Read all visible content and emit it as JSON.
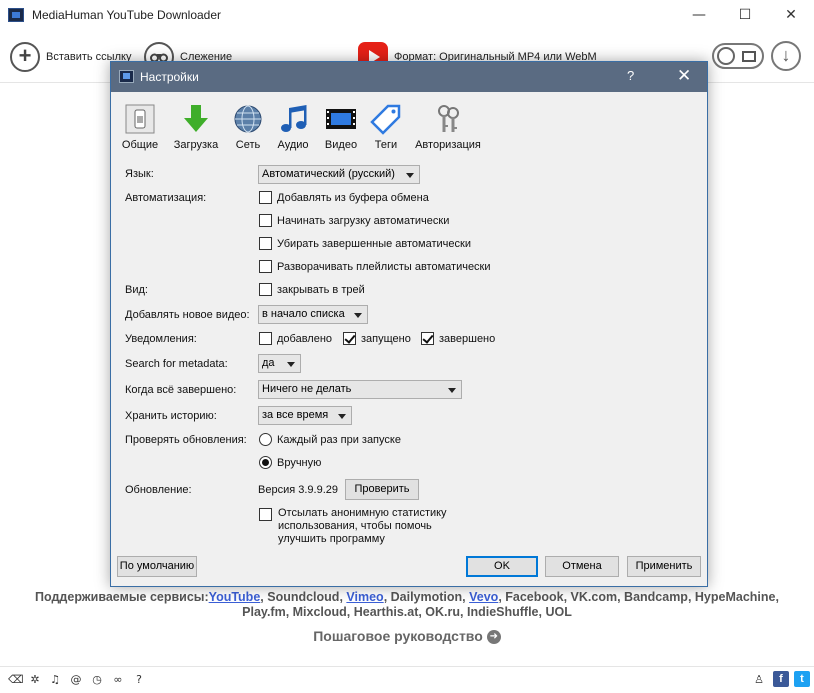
{
  "app": {
    "title": "MediaHuman YouTube Downloader",
    "window_controls": {
      "minimize": "—",
      "maximize": "☐",
      "close": "✕"
    }
  },
  "toolbar": {
    "paste_label": "Вставить ссылку",
    "tracking_label": "Слежение",
    "format_label": "Формат: Оригинальный MP4 или WebM"
  },
  "dialog": {
    "title": "Настройки",
    "help": "?",
    "close": "✕",
    "categories": [
      {
        "label": "Общие",
        "icon": "general-icon"
      },
      {
        "label": "Загрузка",
        "icon": "download-arrow-icon"
      },
      {
        "label": "Сеть",
        "icon": "globe-icon"
      },
      {
        "label": "Аудио",
        "icon": "music-note-icon"
      },
      {
        "label": "Видео",
        "icon": "film-icon"
      },
      {
        "label": "Теги",
        "icon": "tag-icon"
      },
      {
        "label": "Авторизация",
        "icon": "keys-icon"
      }
    ],
    "language": {
      "label": "Язык:",
      "value": "Автоматический (русский)"
    },
    "automation": {
      "label": "Автоматизация:",
      "options": [
        {
          "label": "Добавлять из буфера обмена",
          "checked": false
        },
        {
          "label": "Начинать загрузку автоматически",
          "checked": false
        },
        {
          "label": "Убирать завершенные автоматически",
          "checked": false
        },
        {
          "label": "Разворачивать плейлисты автоматически",
          "checked": false
        }
      ]
    },
    "view": {
      "label": "Вид:",
      "option": "закрывать в трей",
      "checked": false
    },
    "add_new": {
      "label": "Добавлять новое видео:",
      "value": "в начало списка"
    },
    "notifications": {
      "label": "Уведомления:",
      "options": [
        {
          "label": "добавлено",
          "checked": false
        },
        {
          "label": "запущено",
          "checked": true
        },
        {
          "label": "завершено",
          "checked": true
        }
      ]
    },
    "metadata": {
      "label": "Search for metadata:",
      "value": "да"
    },
    "when_done": {
      "label": "Когда всё завершено:",
      "value": "Ничего не делать"
    },
    "history": {
      "label": "Хранить историю:",
      "value": "за все время"
    },
    "updates": {
      "label": "Проверять обновления:",
      "options": [
        {
          "label": "Каждый раз при запуске",
          "checked": false
        },
        {
          "label": "Вручную",
          "checked": true
        }
      ]
    },
    "update": {
      "label": "Обновление:",
      "version": "Версия 3.9.9.29",
      "check_button": "Проверить"
    },
    "stats": {
      "line1": "Отсылать анонимную статистику",
      "line2": "использования, чтобы помочь",
      "line3": "улучшить программу",
      "checked": false
    },
    "buttons": {
      "defaults": "По умолчанию",
      "ok": "OK",
      "cancel": "Отмена",
      "apply": "Применить"
    }
  },
  "footer": {
    "services_prefix": "Поддерживаемые сервисы:",
    "youtube": "YouTube",
    "s1": ", Soundcloud, ",
    "vimeo": "Vimeo",
    "s2": ", Dailymotion, ",
    "vevo": "Vevo",
    "s3": ", Facebook, VK.com, Bandcamp, HypeMachine,",
    "line2": "Play.fm, Mixcloud, Hearthis.at, OK.ru, IndieShuffle, UOL",
    "guide": "Пошаговое руководство"
  },
  "statusbar": {
    "icons": [
      "broom-icon",
      "gear-icon",
      "music-icon",
      "snail-icon",
      "clock-icon",
      "binoculars-icon",
      "help-icon"
    ],
    "help": "?",
    "facebook": "f",
    "twitter": "t"
  },
  "colors": {
    "dialog_title_bg": "#5a6b82",
    "link": "#3b5fd6",
    "youtube_red": "#e62117",
    "facebook": "#3b5998",
    "twitter": "#1da1f2"
  }
}
